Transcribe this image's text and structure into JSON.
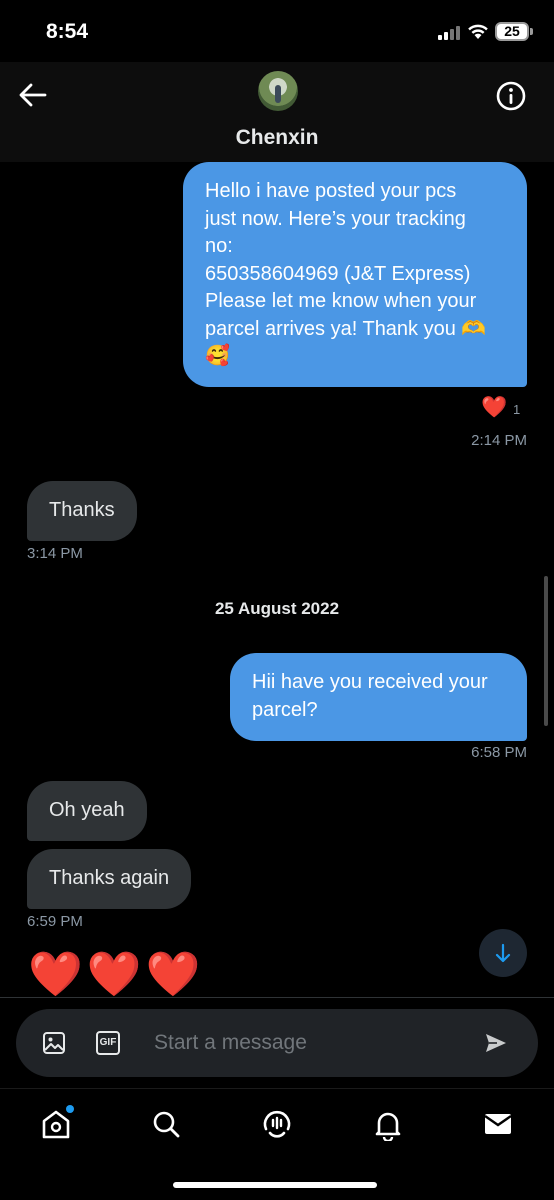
{
  "status_bar": {
    "time": "8:54",
    "battery": "25"
  },
  "header": {
    "contact_name": "Chenxin",
    "back_icon": "arrow-left-icon",
    "info_icon": "info-circle-icon"
  },
  "messages": [
    {
      "direction": "out",
      "lines": [
        "Hello i have posted your pcs",
        "just now. Here’s your tracking",
        "no:",
        "650358604969 (J&T Express)",
        "Please let me know when your",
        "parcel arrives ya! Thank you 🫶",
        "🥰"
      ],
      "reaction": "❤️",
      "reaction_count": "1",
      "time": "2:14 PM"
    },
    {
      "direction": "in",
      "lines": [
        "Thanks"
      ],
      "time": "3:14 PM"
    },
    {
      "date_divider": "25 August 2022"
    },
    {
      "direction": "out",
      "lines": [
        "Hii have you received your",
        "parcel?"
      ],
      "time": "6:58 PM"
    },
    {
      "direction": "in",
      "lines": [
        "Oh yeah"
      ]
    },
    {
      "direction": "in",
      "lines": [
        "Thanks again"
      ],
      "time": "6:59 PM"
    },
    {
      "direction": "in",
      "emoji_text": "❤️❤️❤️"
    }
  ],
  "composer": {
    "placeholder": "Start a message",
    "gif_label": "GIF",
    "image_icon": "image-icon",
    "send_icon": "send-icon"
  },
  "tabbar": {
    "items": [
      "home-icon",
      "search-icon",
      "spaces-icon",
      "notifications-bell-icon",
      "messages-envelope-icon"
    ],
    "active": "home-icon",
    "home_has_badge": true
  },
  "colors": {
    "outgoing_bubble": "#4b97e5",
    "incoming_bubble": "#2f3336",
    "background": "#000000",
    "accent": "#1d9bf0",
    "heart": "#e0245e"
  }
}
